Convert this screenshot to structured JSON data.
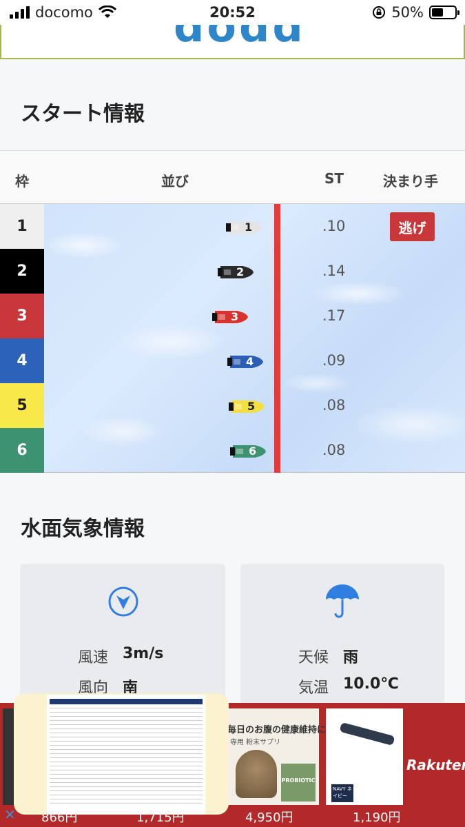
{
  "status_bar": {
    "carrier": "docomo",
    "time": "20:52",
    "battery_pct": "50%",
    "battery_level": 0.5
  },
  "header": {
    "logo_text": "dodd"
  },
  "start_info": {
    "title": "スタート情報",
    "columns": [
      "枠",
      "並び",
      "ST",
      "決まり手"
    ],
    "rows": [
      {
        "waku": "1",
        "boat_number": "1",
        "st": ".10",
        "kimarite": "逃げ",
        "color": "#efefef",
        "text_color": "#222",
        "boat_color": "#e4e4e4"
      },
      {
        "waku": "2",
        "boat_number": "2",
        "st": ".14",
        "kimarite": "",
        "color": "#000000",
        "text_color": "#ffffff",
        "boat_color": "#2a2a2a"
      },
      {
        "waku": "3",
        "boat_number": "3",
        "st": ".17",
        "kimarite": "",
        "color": "#c8373a",
        "text_color": "#ffffff",
        "boat_color": "#d8322e"
      },
      {
        "waku": "4",
        "boat_number": "4",
        "st": ".09",
        "kimarite": "",
        "color": "#2d62b9",
        "text_color": "#ffffff",
        "boat_color": "#2a5fb5"
      },
      {
        "waku": "5",
        "boat_number": "5",
        "st": ".08",
        "kimarite": "",
        "color": "#f8e84a",
        "text_color": "#222",
        "boat_color": "#f3e040"
      },
      {
        "waku": "6",
        "boat_number": "6",
        "st": ".08",
        "kimarite": "",
        "color": "#3c9271",
        "text_color": "#ffffff",
        "boat_color": "#3c9271"
      }
    ]
  },
  "weather": {
    "title": "水面気象情報",
    "wind": {
      "speed_label": "風速",
      "speed_value": "3m/s",
      "direction_label": "風向",
      "direction_value": "南"
    },
    "sky": {
      "weather_label": "天候",
      "weather_value": "雨",
      "temp_label": "気温",
      "temp_value": "10.0℃"
    }
  },
  "ads": {
    "items": [
      {
        "price": "866円"
      },
      {
        "price": "1,715円"
      },
      {
        "text": "毎日のお腹の健康維持に",
        "subtext": "専用 粉末サプリ",
        "badge": "PROBIOTIC",
        "price": "4,950円"
      },
      {
        "badge": "NAVY ネイビー",
        "price": "1,190円"
      }
    ],
    "brand": "Rakuten"
  }
}
